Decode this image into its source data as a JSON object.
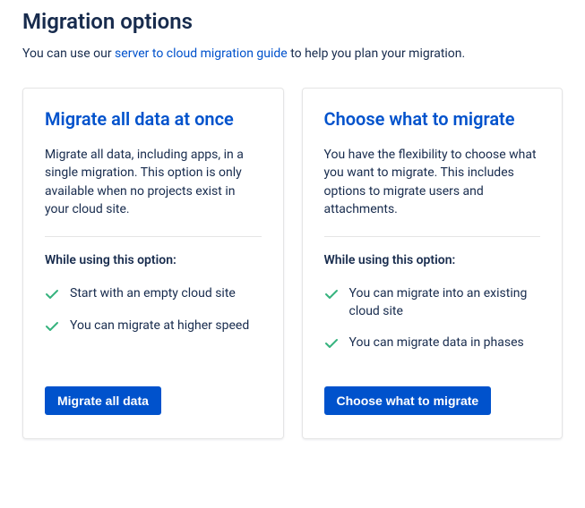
{
  "page": {
    "title": "Migration options",
    "intro_prefix": "You can use our ",
    "intro_link": "server to cloud migration guide",
    "intro_suffix": " to help you plan your migration."
  },
  "cards": [
    {
      "title": "Migrate all data at once",
      "description": "Migrate all data, including apps, in a single migration. This option is only available when no projects exist in your cloud site.",
      "benefits_heading": "While using this option:",
      "benefits": [
        "Start with an empty cloud site",
        "You can migrate at higher speed"
      ],
      "button_label": "Migrate all data"
    },
    {
      "title": "Choose what to migrate",
      "description": "You have the flexibility to choose what you want to migrate. This includes options to migrate users and attachments.",
      "benefits_heading": "While using this option:",
      "benefits": [
        "You can migrate into an existing cloud site",
        "You can migrate data in phases"
      ],
      "button_label": "Choose what to migrate"
    }
  ]
}
